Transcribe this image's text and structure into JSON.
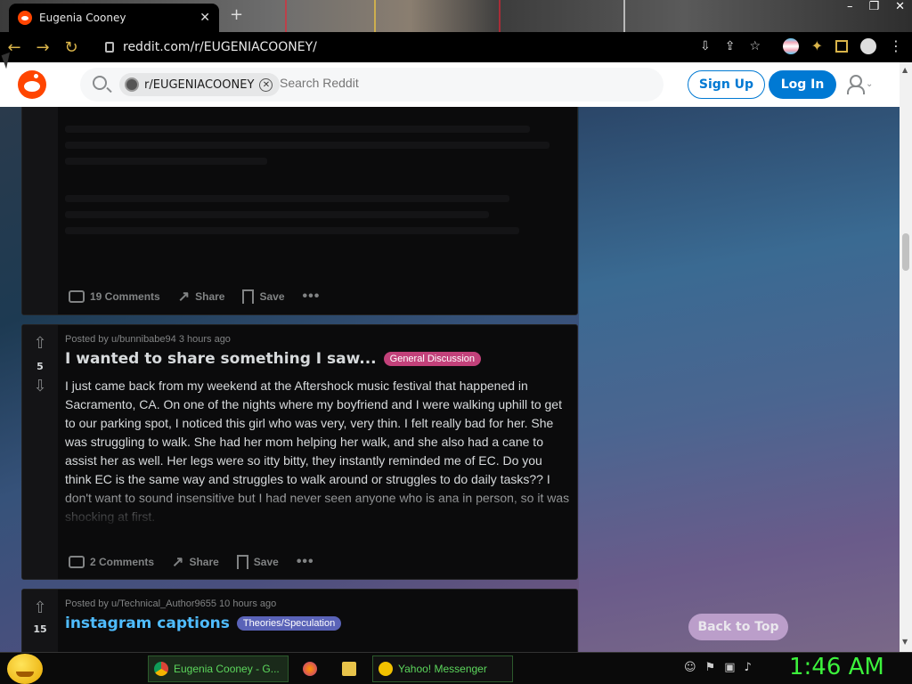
{
  "browser": {
    "tab_title": "Eugenia Cooney",
    "new_tab": "+",
    "url": "reddit.com/r/EUGENIACOONEY/",
    "close_tab": "✕"
  },
  "reddit_header": {
    "chip_label": "r/EUGENIACOONEY",
    "search_placeholder": "Search Reddit",
    "signup_label": "Sign Up",
    "login_label": "Log In",
    "brand_color": "#ff4500",
    "accent_color": "#0079d3"
  },
  "posts": [
    {
      "comments_label": "19 Comments",
      "share_label": "Share",
      "save_label": "Save",
      "more_label": "•••"
    },
    {
      "meta": "Posted by u/bunnibabe94 3 hours ago",
      "score": "5",
      "title": "I wanted to share something I saw...",
      "flair": "General Discussion",
      "flair_color": "#c2417a",
      "text": "I just came back from my weekend at the Aftershock music festival that happened in Sacramento, CA. On one of the nights where my boyfriend and I were walking uphill to get to our parking spot, I noticed this girl who was very, very thin. I felt really bad for her. She was struggling to walk. She had her mom helping her walk, and she also had a cane to assist her as well. Her legs were so itty bitty, they instantly reminded me of EC. Do you think EC is the same way and struggles to walk around or struggles to do daily tasks?? I don't want to sound insensitive but I had never seen anyone who is ana in person, so it was shocking at first.",
      "comments_label": "2 Comments",
      "share_label": "Share",
      "save_label": "Save",
      "more_label": "•••"
    },
    {
      "meta": "Posted by u/Technical_Author9655 10 hours ago",
      "score": "15",
      "title": "instagram captions",
      "flair": "Theories/Speculation",
      "flair_color": "#5a63b8"
    }
  ],
  "back_to_top": "Back to Top",
  "taskbar": {
    "chrome_task": "Eugenia Cooney - G...",
    "yahoo_task": "Yahoo! Messenger",
    "clock": "1:46 AM"
  }
}
